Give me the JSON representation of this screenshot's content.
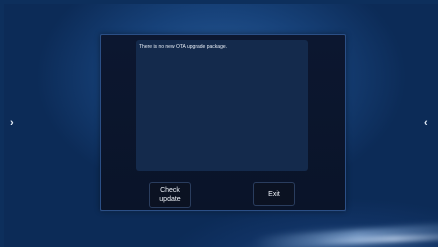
{
  "navigation": {
    "left_arrow": "›",
    "right_arrow": "‹"
  },
  "dialog": {
    "message": "There is no new OTA upgrade package.",
    "buttons": {
      "check_update": "Check update",
      "exit": "Exit"
    }
  }
}
